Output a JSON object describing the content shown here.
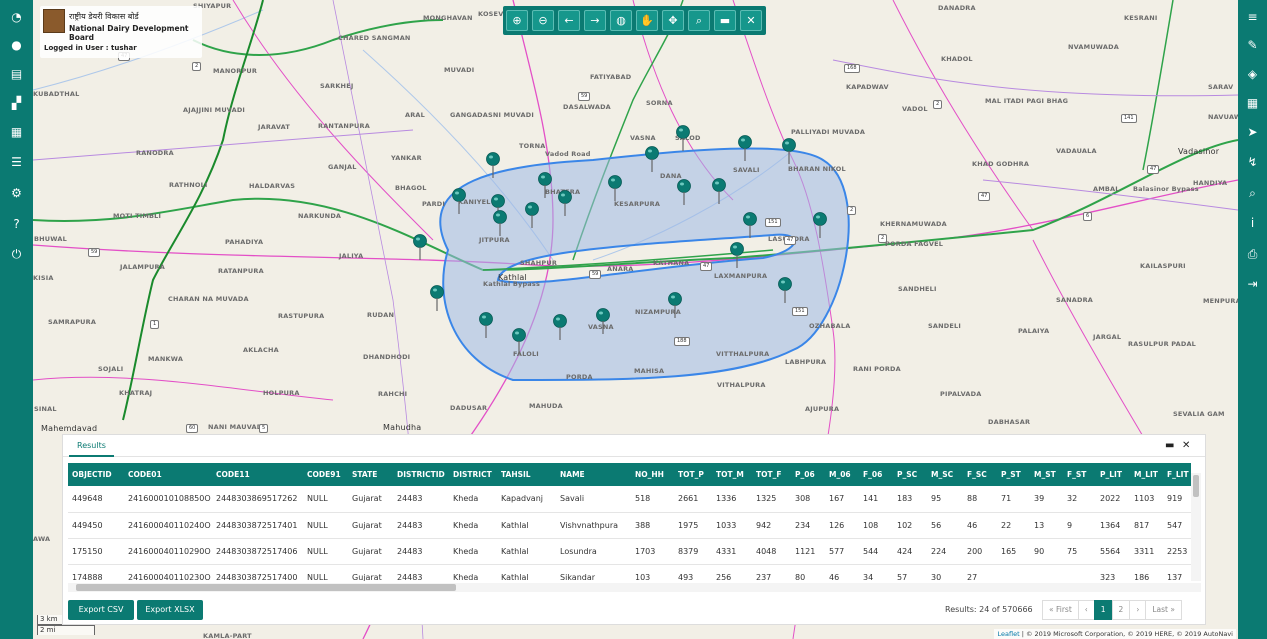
{
  "branding": {
    "hindi": "राष्ट्रीय डेयरी विकास बोर्ड",
    "english": "National Dairy Development Board",
    "user_label": "Logged in User : tushar"
  },
  "left_sidebar": [
    {
      "icon": "dashboard-icon",
      "glyph": "◔"
    },
    {
      "icon": "user-icon",
      "glyph": "●"
    },
    {
      "icon": "document-icon",
      "glyph": "▤"
    },
    {
      "icon": "map-icon",
      "glyph": "▞"
    },
    {
      "icon": "table-icon",
      "glyph": "▦"
    },
    {
      "icon": "list-icon",
      "glyph": "☰"
    },
    {
      "icon": "settings-icon",
      "glyph": "⚙"
    },
    {
      "icon": "help-icon",
      "glyph": "?"
    },
    {
      "icon": "power-icon",
      "glyph": "⏻"
    }
  ],
  "right_sidebar": [
    {
      "icon": "database-icon",
      "glyph": "≡"
    },
    {
      "icon": "edit-icon",
      "glyph": "✎"
    },
    {
      "icon": "layers-icon",
      "glyph": "◈"
    },
    {
      "icon": "calculator-icon",
      "glyph": "▦"
    },
    {
      "icon": "navigate-icon",
      "glyph": "➤"
    },
    {
      "icon": "route-icon",
      "glyph": "↯"
    },
    {
      "icon": "search-icon",
      "glyph": "⌕"
    },
    {
      "icon": "info-icon",
      "glyph": "i"
    },
    {
      "icon": "print-icon",
      "glyph": "⎙"
    },
    {
      "icon": "export-icon",
      "glyph": "⇥"
    }
  ],
  "toolbar": [
    {
      "icon": "zoom-in-icon",
      "glyph": "⊕"
    },
    {
      "icon": "zoom-out-icon",
      "glyph": "⊖"
    },
    {
      "icon": "back-arrow-icon",
      "glyph": "←"
    },
    {
      "icon": "forward-arrow-icon",
      "glyph": "→"
    },
    {
      "icon": "globe-icon",
      "glyph": "◍"
    },
    {
      "icon": "hand-pan-icon",
      "glyph": "✋"
    },
    {
      "icon": "move-icon",
      "glyph": "✥"
    },
    {
      "icon": "zoom-box-icon",
      "glyph": "⌕"
    },
    {
      "icon": "minimize-icon",
      "glyph": "▬"
    },
    {
      "icon": "close-icon",
      "glyph": "✕"
    }
  ],
  "map": {
    "places": [
      {
        "n": "SHIYAPUR"
      },
      {
        "n": "CHARED SANGMAN"
      },
      {
        "n": "MONGHAVAN"
      },
      {
        "n": "KOSEVAL"
      },
      {
        "n": "DANADRA"
      },
      {
        "n": "KESRANI"
      },
      {
        "n": "NVAMUWADA"
      },
      {
        "n": "KHADOL"
      },
      {
        "n": "KAPADWAV"
      },
      {
        "n": "VADOL"
      },
      {
        "n": "MAL ITADI PAGI BHAG"
      },
      {
        "n": "SARAV"
      },
      {
        "n": "NAVUAWADA"
      },
      {
        "n": "VADAUALA"
      },
      {
        "n": "KHAD GODHRA"
      },
      {
        "n": "Vadasinor"
      },
      {
        "n": "HANDIYA"
      },
      {
        "n": "AMBAL"
      },
      {
        "n": "PALLIYADI MUVADA"
      },
      {
        "n": "MANORPUR"
      },
      {
        "n": "MUVADI"
      },
      {
        "n": "FATIYABAD"
      },
      {
        "n": "AJAJJINI MUVADI"
      },
      {
        "n": "SARKHEJ"
      },
      {
        "n": "KUBADTHAL"
      },
      {
        "n": "JARAVAT"
      },
      {
        "n": "RANTANPURA"
      },
      {
        "n": "ARAL"
      },
      {
        "n": "GANGADASNI MUVADI"
      },
      {
        "n": "DASALWADA"
      },
      {
        "n": "SORNA"
      },
      {
        "n": "RANODRA"
      },
      {
        "n": "RATHNOLI"
      },
      {
        "n": "HALDARVAS"
      },
      {
        "n": "YANKAR"
      },
      {
        "n": "GANJAL"
      },
      {
        "n": "BHAGOL"
      },
      {
        "n": "TORNA"
      },
      {
        "n": "VASNA"
      },
      {
        "n": "SALOD"
      },
      {
        "n": "DANA"
      },
      {
        "n": "SAVALI"
      },
      {
        "n": "BHARAN NIKOL"
      },
      {
        "n": "MOTI TIMBLI"
      },
      {
        "n": "NARKUNDA"
      },
      {
        "n": "PARDI"
      },
      {
        "n": "KANIYEL"
      },
      {
        "n": "BHATERA"
      },
      {
        "n": "KESARPURA"
      },
      {
        "n": "KHERNAMUWADA"
      },
      {
        "n": "BHUWAL"
      },
      {
        "n": "PAHADIYA"
      },
      {
        "n": "JALIYA"
      },
      {
        "n": "JITPURA"
      },
      {
        "n": "LASUNDRA"
      },
      {
        "n": "PORDA FAGVEL"
      },
      {
        "n": "JALAMPURA"
      },
      {
        "n": "RATANPURA"
      },
      {
        "n": "SHAHPUR"
      },
      {
        "n": "ANARA"
      },
      {
        "n": "KATHANA"
      },
      {
        "n": "LAXMANPURA"
      },
      {
        "n": "KAILASPURI"
      },
      {
        "n": "KISIA"
      },
      {
        "n": "Kathlal"
      },
      {
        "n": "SANDHELI"
      },
      {
        "n": "SANADRA"
      },
      {
        "n": "MENPURA"
      },
      {
        "n": "CHARAN NA MUVADA"
      },
      {
        "n": "RASTUPURA"
      },
      {
        "n": "RUDAN"
      },
      {
        "n": "NIZAMPURA"
      },
      {
        "n": "SAMRAPURA"
      },
      {
        "n": "VASNA"
      },
      {
        "n": "OZHABALA"
      },
      {
        "n": "SANDELI"
      },
      {
        "n": "PALAIYA"
      },
      {
        "n": "JARGAL"
      },
      {
        "n": "RASULPUR PADAL"
      },
      {
        "n": "FALOLI"
      },
      {
        "n": "MANKWA"
      },
      {
        "n": "AKLACHA"
      },
      {
        "n": "DHANDHODI"
      },
      {
        "n": "VITTHALPURA"
      },
      {
        "n": "LABHPURA"
      },
      {
        "n": "MAHISA"
      },
      {
        "n": "RANI PORDA"
      },
      {
        "n": "SOJALI"
      },
      {
        "n": "KHATRAJ"
      },
      {
        "n": "HOLPURA"
      },
      {
        "n": "RAHCHI"
      },
      {
        "n": "VITHALPURA"
      },
      {
        "n": "PIPALVADA"
      },
      {
        "n": "SINAL"
      },
      {
        "n": "PORDA"
      },
      {
        "n": "DADUSAR"
      },
      {
        "n": "MAHUDA"
      },
      {
        "n": "AJUPURA"
      },
      {
        "n": "DABHASAR"
      },
      {
        "n": "SEVALIA GAM"
      },
      {
        "n": "Mahemdavad"
      },
      {
        "n": "NANI MAUVADI"
      },
      {
        "n": "Mahudha"
      },
      {
        "n": "AWA"
      },
      {
        "n": "KAMLA-PART"
      },
      {
        "n": "Kathlal Bypass"
      },
      {
        "n": "Balasinor Bypass"
      },
      {
        "n": "Vadod Road"
      }
    ],
    "shields": [
      "47",
      "2",
      "168",
      "59",
      "141",
      "2",
      "47",
      "47",
      "2",
      "59",
      "47",
      "151",
      "1",
      "188",
      "151",
      "60",
      "5",
      "8",
      "47",
      "6",
      "2",
      "59"
    ]
  },
  "scale": {
    "km": "3 km",
    "mi": "2 mi"
  },
  "attribution": {
    "leaflet": "Leaflet",
    "rest": " | © 2019 Microsoft Corporation, © 2019 HERE, © 2019 AutoNavi"
  },
  "panel": {
    "tab": "Results",
    "columns": [
      "OBJECTID",
      "CODE01",
      "CODE11",
      "CODE91",
      "STATE",
      "DISTRICTID",
      "DISTRICT",
      "TAHSIL",
      "NAME",
      "NO_HH",
      "TOT_P",
      "TOT_M",
      "TOT_F",
      "P_06",
      "M_06",
      "F_06",
      "P_SC",
      "M_SC",
      "F_SC",
      "P_ST",
      "M_ST",
      "F_ST",
      "P_LIT",
      "M_LIT",
      "F_LIT"
    ],
    "rows": [
      [
        "449648",
        "241600010108850O",
        "2448303869517262",
        "NULL",
        "Gujarat",
        "24483",
        "Kheda",
        "Kapadvanj",
        "Savali",
        "518",
        "2661",
        "1336",
        "1325",
        "308",
        "167",
        "141",
        "183",
        "95",
        "88",
        "71",
        "39",
        "32",
        "2022",
        "1103",
        "919"
      ],
      [
        "449450",
        "241600040110240O",
        "2448303872517401",
        "NULL",
        "Gujarat",
        "24483",
        "Kheda",
        "Kathlal",
        "Vishvnathpura",
        "388",
        "1975",
        "1033",
        "942",
        "234",
        "126",
        "108",
        "102",
        "56",
        "46",
        "22",
        "13",
        "9",
        "1364",
        "817",
        "547"
      ],
      [
        "175150",
        "241600040110290O",
        "2448303872517406",
        "NULL",
        "Gujarat",
        "24483",
        "Kheda",
        "Kathlal",
        "Losundra",
        "1703",
        "8379",
        "4331",
        "4048",
        "1121",
        "577",
        "544",
        "424",
        "224",
        "200",
        "165",
        "90",
        "75",
        "5564",
        "3311",
        "2253"
      ],
      [
        "174888",
        "241600040110230O",
        "2448303872517400",
        "NULL",
        "Gujarat",
        "24483",
        "Kheda",
        "Kathlal",
        "Sikandar",
        "103",
        "493",
        "256",
        "237",
        "80",
        "46",
        "34",
        "57",
        "30",
        "27",
        "",
        "",
        "",
        "323",
        "186",
        "137"
      ]
    ],
    "export_csv": "Export CSV",
    "export_xlsx": "Export XLSX",
    "results_text": "Results: 24 of 570666",
    "pagination": [
      "« First",
      "‹",
      "1",
      "2",
      "›",
      "Last »"
    ],
    "active_page": "1"
  },
  "colors": {
    "sidebar": "#0b7a72",
    "buffer_fill": "#b4c8e8",
    "buffer_stroke": "#3a86e8",
    "pin": "#0b7a72"
  }
}
